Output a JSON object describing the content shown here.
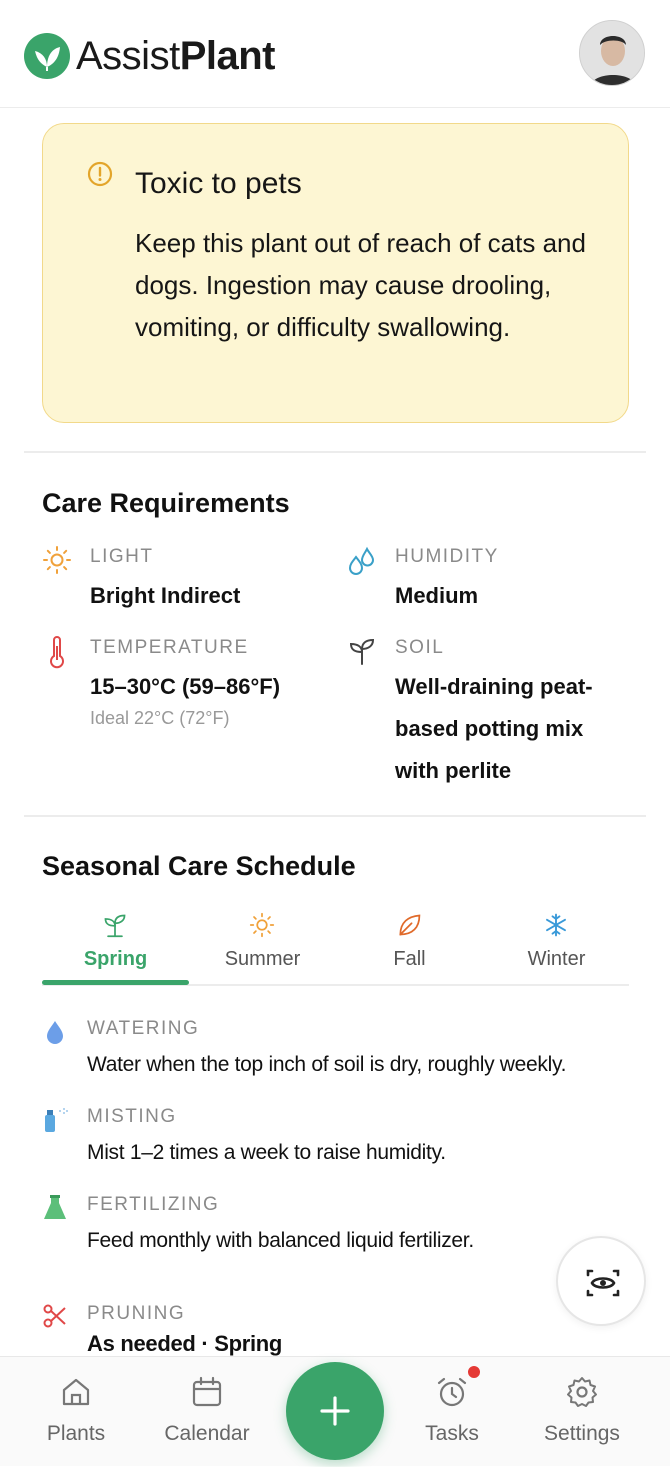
{
  "app": {
    "brand_part1": "Assist",
    "brand_part2": "Plant"
  },
  "warning": {
    "title": "Toxic to pets",
    "body": "Keep this plant out of reach of cats and dogs. Ingestion may cause drooling, vomiting, or difficulty swallowing.",
    "icon": "alert-circle-icon"
  },
  "care": {
    "title": "Care Requirements",
    "light": {
      "label": "LIGHT",
      "value": "Bright Indirect",
      "icon": "sun-icon"
    },
    "humidity": {
      "label": "HUMIDITY",
      "value": "Medium",
      "icon": "droplets-icon"
    },
    "temperature": {
      "label": "TEMPERATURE",
      "value": "15–30°C (59–86°F)",
      "sub": "Ideal 22°C (72°F)",
      "icon": "thermometer-icon"
    },
    "soil": {
      "label": "SOIL",
      "value_lines": [
        "Well-draining peat-",
        "based potting mix",
        "with perlite"
      ],
      "icon": "sprout-icon"
    }
  },
  "seasonal": {
    "title": "Seasonal Care Schedule",
    "tabs": [
      {
        "label": "Spring",
        "icon": "sprout-icon",
        "active": true
      },
      {
        "label": "Summer",
        "icon": "sun-icon",
        "active": false
      },
      {
        "label": "Fall",
        "icon": "leaf-icon",
        "active": false
      },
      {
        "label": "Winter",
        "icon": "snowflake-icon",
        "active": false
      }
    ],
    "items": [
      {
        "label": "WATERING",
        "value": "Water when the top inch of soil is dry, roughly weekly.",
        "icon": "water-drop-icon"
      },
      {
        "label": "MISTING",
        "value": "Mist 1–2 times a week to raise humidity.",
        "icon": "spray-bottle-icon"
      },
      {
        "label": "FERTILIZING",
        "value": "Feed monthly with balanced liquid fertilizer.",
        "icon": "flask-icon"
      },
      {
        "label": "PRUNING",
        "value": "As needed · Spring",
        "icon": "scissors-icon"
      }
    ]
  },
  "nav": {
    "items": [
      {
        "label": "Plants",
        "icon": "home-icon"
      },
      {
        "label": "Calendar",
        "icon": "calendar-icon"
      },
      {
        "label": "Tasks",
        "icon": "alarm-clock-icon"
      },
      {
        "label": "Settings",
        "icon": "gear-icon"
      }
    ]
  },
  "colors": {
    "accent": "#3aa46a",
    "warning_bg": "#fdf6d3",
    "warning_border": "#f2d98a",
    "badge": "#e53935"
  }
}
